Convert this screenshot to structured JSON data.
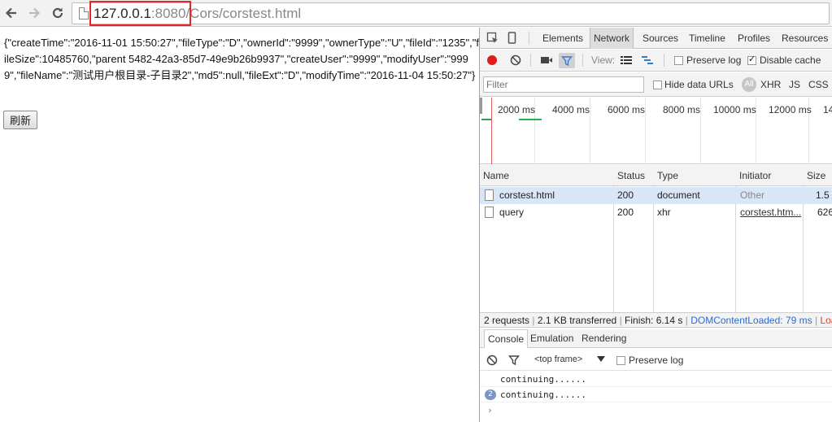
{
  "browser": {
    "url_host": "127.0.0.1",
    "url_port": ":8080/",
    "url_path": "Cors/corstest.html",
    "highlight_color": "#e0282b"
  },
  "page": {
    "json_text": "{\"createTime\":\"2016-11-01 15:50:27\",\"fileType\":\"D\",\"ownerId\":\"9999\",\"ownerType\":\"U\",\"fileId\":\"1235\",\"fileSize\":10485760,\"parent 5482-42a3-85d7-49e9b26b9937\",\"createUser\":\"9999\",\"modifyUser\":\"9999\",\"fileName\":\"测试用户根目录-子目录2\",\"md5\":null,\"fileExt\":\"D\",\"modifyTime\":\"2016-11-04 15:50:27\"}",
    "refresh_label": "刷新"
  },
  "devtools": {
    "tabs": [
      "Elements",
      "Network",
      "Sources",
      "Timeline",
      "Profiles",
      "Resources"
    ],
    "active_tab": "Network",
    "toolbar": {
      "view_label": "View:",
      "preserve_log": "Preserve log",
      "disable_cache": "Disable cache",
      "preserve_log_checked": false,
      "disable_cache_checked": true
    },
    "filter": {
      "placeholder": "Filter",
      "hide_data_urls": "Hide data URLs",
      "types": [
        "All",
        "XHR",
        "JS",
        "CSS"
      ]
    },
    "timeline_ticks": [
      "2000 ms",
      "4000 ms",
      "6000 ms",
      "8000 ms",
      "10000 ms",
      "12000 ms",
      "14"
    ],
    "columns": [
      "Name",
      "Status",
      "Type",
      "Initiator",
      "Size"
    ],
    "requests": [
      {
        "name": "corstest.html",
        "status": "200",
        "type": "document",
        "initiator": "Other",
        "size": "1.5"
      },
      {
        "name": "query",
        "status": "200",
        "type": "xhr",
        "initiator": "corstest.htm...",
        "size": "626"
      }
    ],
    "summary": {
      "requests": "2 requests",
      "transferred": "2.1 KB transferred",
      "finish": "Finish: 6.14 s",
      "dcl": "DOMContentLoaded: 79 ms",
      "load": "Loa"
    },
    "drawer_tabs": [
      "Console",
      "Emulation",
      "Rendering"
    ],
    "console": {
      "context": "<top frame>",
      "preserve_log": "Preserve log",
      "messages": [
        "continuing......",
        "continuing......"
      ],
      "repeat_count": "2",
      "prompt": "›"
    }
  }
}
